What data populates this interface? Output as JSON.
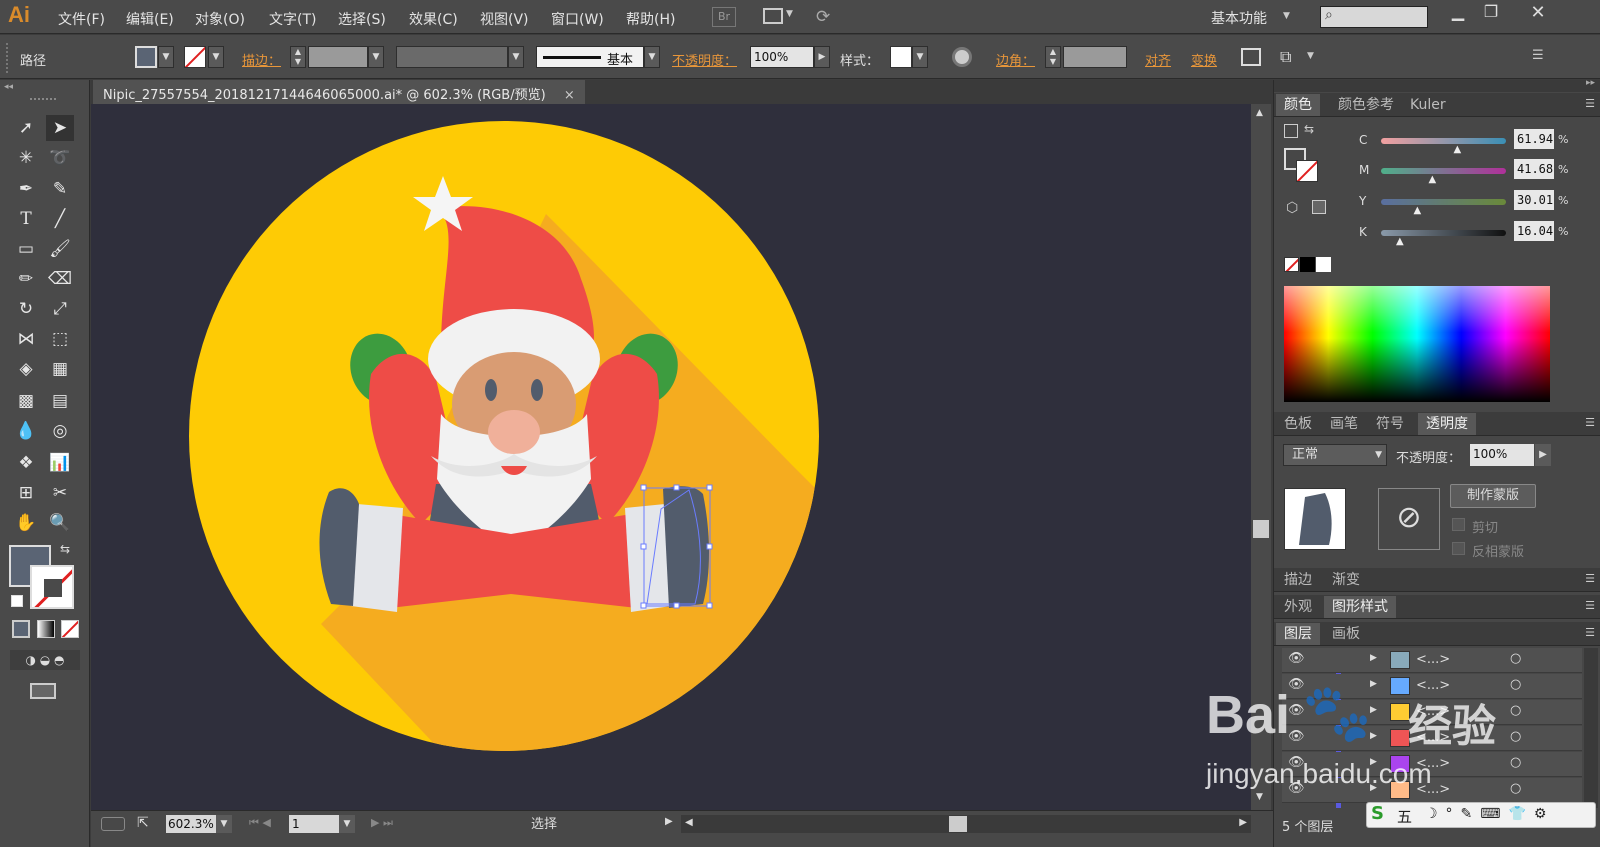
{
  "app": {
    "logo": "Ai",
    "menu": [
      "文件(F)",
      "编辑(E)",
      "对象(O)",
      "文字(T)",
      "选择(S)",
      "效果(C)",
      "视图(V)",
      "窗口(W)",
      "帮助(H)"
    ],
    "bridge": "Br",
    "workspace": "基本功能",
    "window_controls": [
      "minimize-icon",
      "restore-icon",
      "close-icon"
    ]
  },
  "control_bar": {
    "object_type": "路径",
    "stroke_label": "描边：",
    "stroke_style": "基本",
    "opacity_label": "不透明度：",
    "opacity_value": "100%",
    "style_label": "样式：",
    "corner_label": "边角：",
    "align_label": "对齐",
    "transform_label": "变换"
  },
  "document": {
    "tab_title": "Nipic_27557554_20181217144646065000.ai* @ 602.3% (RGB/预览)",
    "close": "×"
  },
  "status_bar": {
    "zoom": "602.3%",
    "artboard": "1",
    "tool": "选择"
  },
  "color_panel": {
    "tabs": [
      "颜色",
      "颜色参考",
      "Kuler"
    ],
    "channels": [
      {
        "name": "C",
        "value": "61.94",
        "pct": "%",
        "level": 0.62
      },
      {
        "name": "M",
        "value": "41.68",
        "pct": "%",
        "level": 0.42
      },
      {
        "name": "Y",
        "value": "30.01",
        "pct": "%",
        "level": 0.3
      },
      {
        "name": "K",
        "value": "16.04",
        "pct": "%",
        "level": 0.16
      }
    ],
    "fill_color": "#5a6474"
  },
  "transparency_panel": {
    "tabs": [
      "色板",
      "画笔",
      "符号",
      "透明度"
    ],
    "blend_mode": "正常",
    "opacity_label": "不透明度：",
    "opacity_value": "100%",
    "make_mask": "制作蒙版",
    "clip": "剪切",
    "invert_mask": "反相蒙版"
  },
  "stroke_gradient_panel": {
    "tabs": [
      "描边",
      "渐变"
    ]
  },
  "appearance_panel": {
    "tabs": [
      "外观",
      "图形样式"
    ]
  },
  "layers_panel": {
    "tabs": [
      "图层",
      "画板"
    ],
    "rows": [
      {
        "name": "<...>"
      },
      {
        "name": "<...>"
      },
      {
        "name": "<...>"
      },
      {
        "name": "<...>"
      },
      {
        "name": "<...>"
      },
      {
        "name": "<...>"
      }
    ],
    "count": "5 个图层"
  },
  "watermark": {
    "brand": "Bai",
    "brand2": "经验",
    "url": "jingyan.baidu.com"
  },
  "ime": {
    "label": "五"
  },
  "colors": {
    "yellow": "#fecb05",
    "shadow": "#f5ac1f",
    "red": "#ee4c47",
    "green": "#3d9c3f",
    "white": "#f2f2f2",
    "skin": "#d99c73",
    "nose": "#f0b09a",
    "dark": "#525c6c"
  }
}
